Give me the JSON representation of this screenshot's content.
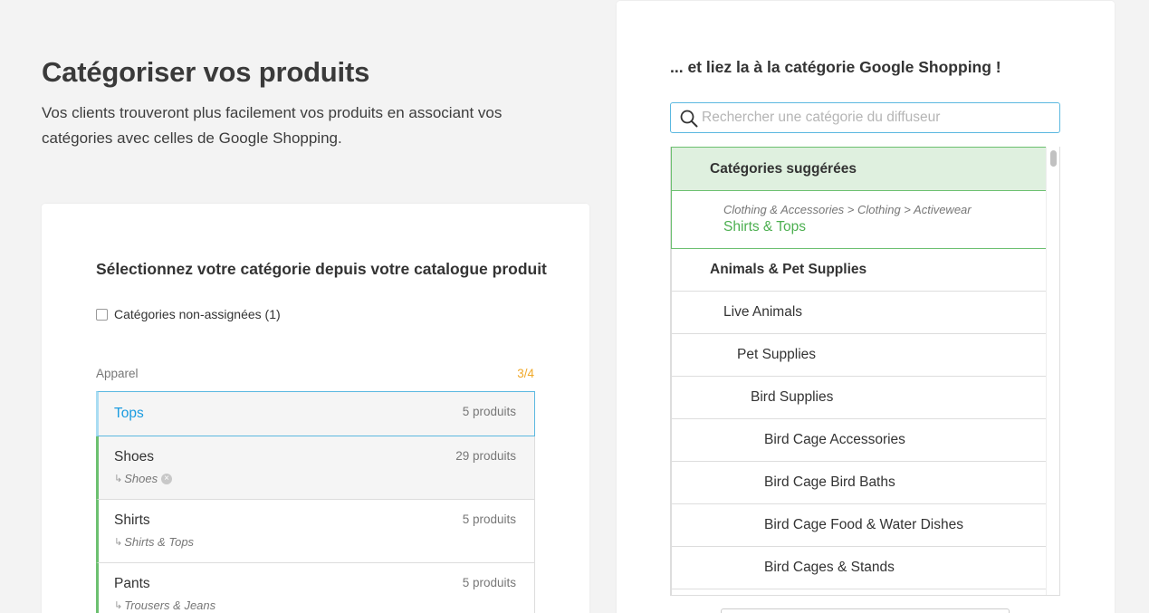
{
  "header": {
    "title": "Catégoriser vos produits",
    "description": "Vos clients trouveront plus facilement vos produits en associant vos catégories avec celles de Google Shopping."
  },
  "left_panel": {
    "title": "Sélectionnez votre catégorie depuis votre catalogue produit",
    "checkbox_label": "Catégories non-assignées (1)",
    "group_label": "Apparel",
    "group_count": "3/4",
    "categories": [
      {
        "name": "Tops",
        "count": "5 produits",
        "mapped": ""
      },
      {
        "name": "Shoes",
        "count": "29 produits",
        "mapped": "Shoes"
      },
      {
        "name": "Shirts",
        "count": "5 produits",
        "mapped": "Shirts & Tops"
      },
      {
        "name": "Pants",
        "count": "5 produits",
        "mapped": "Trousers & Jeans"
      }
    ],
    "sub_arrow": "↳",
    "remove_glyph": "×"
  },
  "right_panel": {
    "title": "... et liez la à la catégorie Google Shopping !",
    "search_placeholder": "Rechercher une catégorie du diffuseur",
    "suggested_header": "Catégories suggérées",
    "suggested_path": "Clothing & Accessories > Clothing > Activewear",
    "suggested_name": "Shirts & Tops",
    "tree": [
      {
        "label": "Animals & Pet Supplies",
        "level": 0
      },
      {
        "label": "Live Animals",
        "level": 1
      },
      {
        "label": "Pet Supplies",
        "level": 2
      },
      {
        "label": "Bird Supplies",
        "level": 3
      },
      {
        "label": "Bird Cage Accessories",
        "level": 4
      },
      {
        "label": "Bird Cage Bird Baths",
        "level": 4
      },
      {
        "label": "Bird Cage Food & Water Dishes",
        "level": 4
      },
      {
        "label": "Bird Cages & Stands",
        "level": 4
      }
    ]
  },
  "icons": {
    "search": "search-icon",
    "remove": "close-circle-icon"
  },
  "colors": {
    "accent_blue": "#1a9be0",
    "accent_green": "#4caf50",
    "count_orange": "#f0a92a",
    "suggest_bg": "#dff0df"
  }
}
